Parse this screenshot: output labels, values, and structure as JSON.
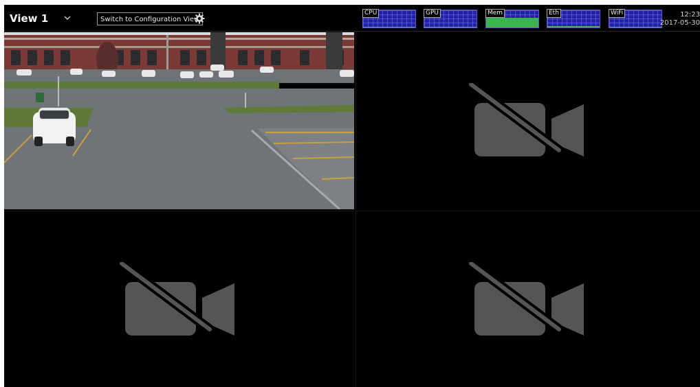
{
  "header": {
    "view_title": "View 1",
    "config_button_label": "Switch to Configuration View",
    "clock_time": "12:23",
    "clock_date": "2017-05-30"
  },
  "meters": [
    {
      "label": "CPU",
      "level": 0.04
    },
    {
      "label": "GPU",
      "level": 0.04
    },
    {
      "label": "Mem",
      "level": 0.55
    },
    {
      "label": "Eth",
      "level": 0.08
    },
    {
      "label": "WiFi",
      "level": 0.02
    }
  ],
  "colors": {
    "meter_bg": "#2222a8",
    "meter_fill": "#3ab54a",
    "no_video_icon": "#555555"
  },
  "tiles": [
    {
      "state": "live-feed"
    },
    {
      "state": "no-video",
      "icon": "video-off-icon"
    },
    {
      "state": "no-video",
      "icon": "video-off-icon"
    },
    {
      "state": "no-video",
      "icon": "video-off-icon"
    }
  ]
}
